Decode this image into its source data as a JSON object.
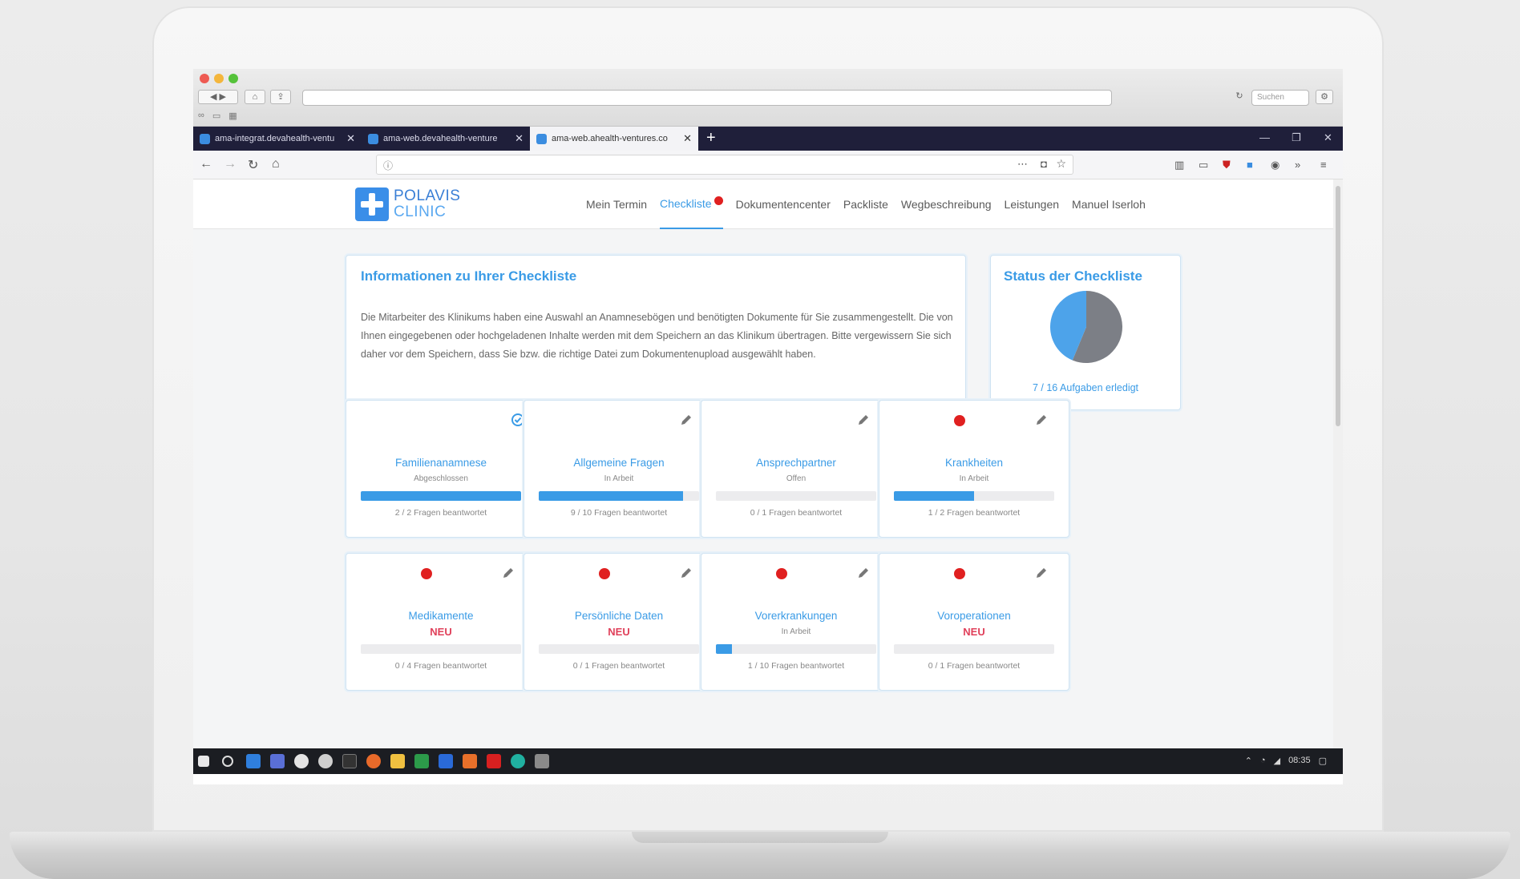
{
  "browser": {
    "outer_search_placeholder": "Suchen",
    "tabs": [
      {
        "label": "ama-integrat.devahealth-ventu"
      },
      {
        "label": "ama-web.devahealth-venture"
      },
      {
        "label": "ama-web.ahealth-ventures.co"
      }
    ]
  },
  "site": {
    "logo_line1": "POLAVIS",
    "logo_line2": "CLINIC",
    "menu": [
      {
        "label": "Mein Termin"
      },
      {
        "label": "Checkliste",
        "active": true
      },
      {
        "label": "Dokumentencenter"
      },
      {
        "label": "Packliste"
      },
      {
        "label": "Wegbeschreibung"
      },
      {
        "label": "Leistungen"
      },
      {
        "label": "Manuel Iserloh"
      }
    ]
  },
  "info": {
    "title": "Informationen zu Ihrer Checkliste",
    "text": "Die Mitarbeiter des Klinikums haben eine Auswahl an Anamnesebögen und benötigten Dokumente für Sie zusammengestellt. Die von Ihnen eingegebenen oder hochgeladenen Inhalte werden mit dem Speichern an das Klinikum übertragen. Bitte vergewissern Sie sich daher vor dem Speichern, dass Sie bzw. die richtige Datei zum Dokumentenupload ausgewählt haben."
  },
  "status": {
    "title": "Status der Checkliste",
    "label": "7 / 16 Aufgaben erledigt",
    "done": 7,
    "total": 16,
    "color_done": "#4da3ea",
    "color_open": "#7c7f86"
  },
  "tasks": [
    {
      "title": "Familienanamnese",
      "status": "Abgeschlossen",
      "count": "2 / 2 Fragen beantwortet",
      "progress": 1.0,
      "new": false,
      "dot": false,
      "icon": "check-circle-icon"
    },
    {
      "title": "Allgemeine Fragen",
      "status": "In Arbeit",
      "count": "9 / 10 Fragen beantwortet",
      "progress": 0.9,
      "new": false,
      "dot": false,
      "icon": "pencil-icon"
    },
    {
      "title": "Ansprechpartner",
      "status": "Offen",
      "count": "0 / 1 Fragen beantwortet",
      "progress": 0.0,
      "new": false,
      "dot": false,
      "icon": "pencil-icon"
    },
    {
      "title": "Krankheiten",
      "status": "In Arbeit",
      "count": "1 / 2 Fragen beantwortet",
      "progress": 0.5,
      "new": false,
      "dot": true,
      "icon": "pencil-icon"
    },
    {
      "title": "Medikamente",
      "status": "NEU",
      "count": "0 / 4 Fragen beantwortet",
      "progress": 0.0,
      "new": true,
      "dot": true,
      "icon": "pencil-icon"
    },
    {
      "title": "Persönliche Daten",
      "status": "NEU",
      "count": "0 / 1 Fragen beantwortet",
      "progress": 0.0,
      "new": true,
      "dot": true,
      "icon": "pencil-icon"
    },
    {
      "title": "Vorerkrankungen",
      "status": "In Arbeit",
      "count": "1 / 10 Fragen beantwortet",
      "progress": 0.1,
      "new": false,
      "dot": true,
      "icon": "pencil-icon"
    },
    {
      "title": "Voroperationen",
      "status": "NEU",
      "count": "0 / 1 Fragen beantwortet",
      "progress": 0.0,
      "new": true,
      "dot": true,
      "icon": "pencil-icon"
    }
  ],
  "taskbar": {
    "clock": "08:35"
  }
}
